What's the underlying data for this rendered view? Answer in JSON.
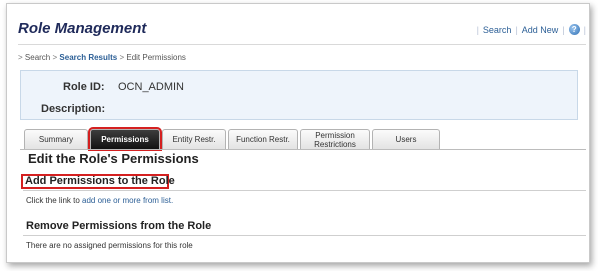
{
  "header": {
    "title": "Role Management",
    "links": {
      "search": "Search",
      "add_new": "Add New"
    },
    "separator": "|"
  },
  "breadcrumb": {
    "lead": ">",
    "items": [
      "Search",
      "Search Results",
      "Edit Permissions"
    ],
    "separator": ">"
  },
  "info": {
    "role_id_label": "Role ID:",
    "role_id_value": "OCN_ADMIN",
    "description_label": "Description:",
    "description_value": ""
  },
  "tabs": [
    {
      "label": "Summary",
      "active": false
    },
    {
      "label": "Permissions",
      "active": true
    },
    {
      "label": "Entity Restr.",
      "active": false
    },
    {
      "label": "Function Restr.",
      "active": false
    },
    {
      "label": "Permission Restrictions",
      "active": false
    },
    {
      "label": "Users",
      "active": false
    }
  ],
  "main": {
    "title": "Edit the Role's Permissions",
    "add_section": {
      "heading": "Add Permissions to the Role",
      "text_prefix": "Click the link to ",
      "link_text": "add one or more from list."
    },
    "remove_section": {
      "heading": "Remove Permissions from the Role",
      "text": "There are no assigned permissions for this role"
    }
  },
  "colors": {
    "title": "#1f2a5a",
    "link": "#2c5f96",
    "active_tab": "#111111",
    "highlight": "#d42020",
    "info_background": "#eef4fb"
  },
  "icons": {
    "help": "help-icon"
  }
}
